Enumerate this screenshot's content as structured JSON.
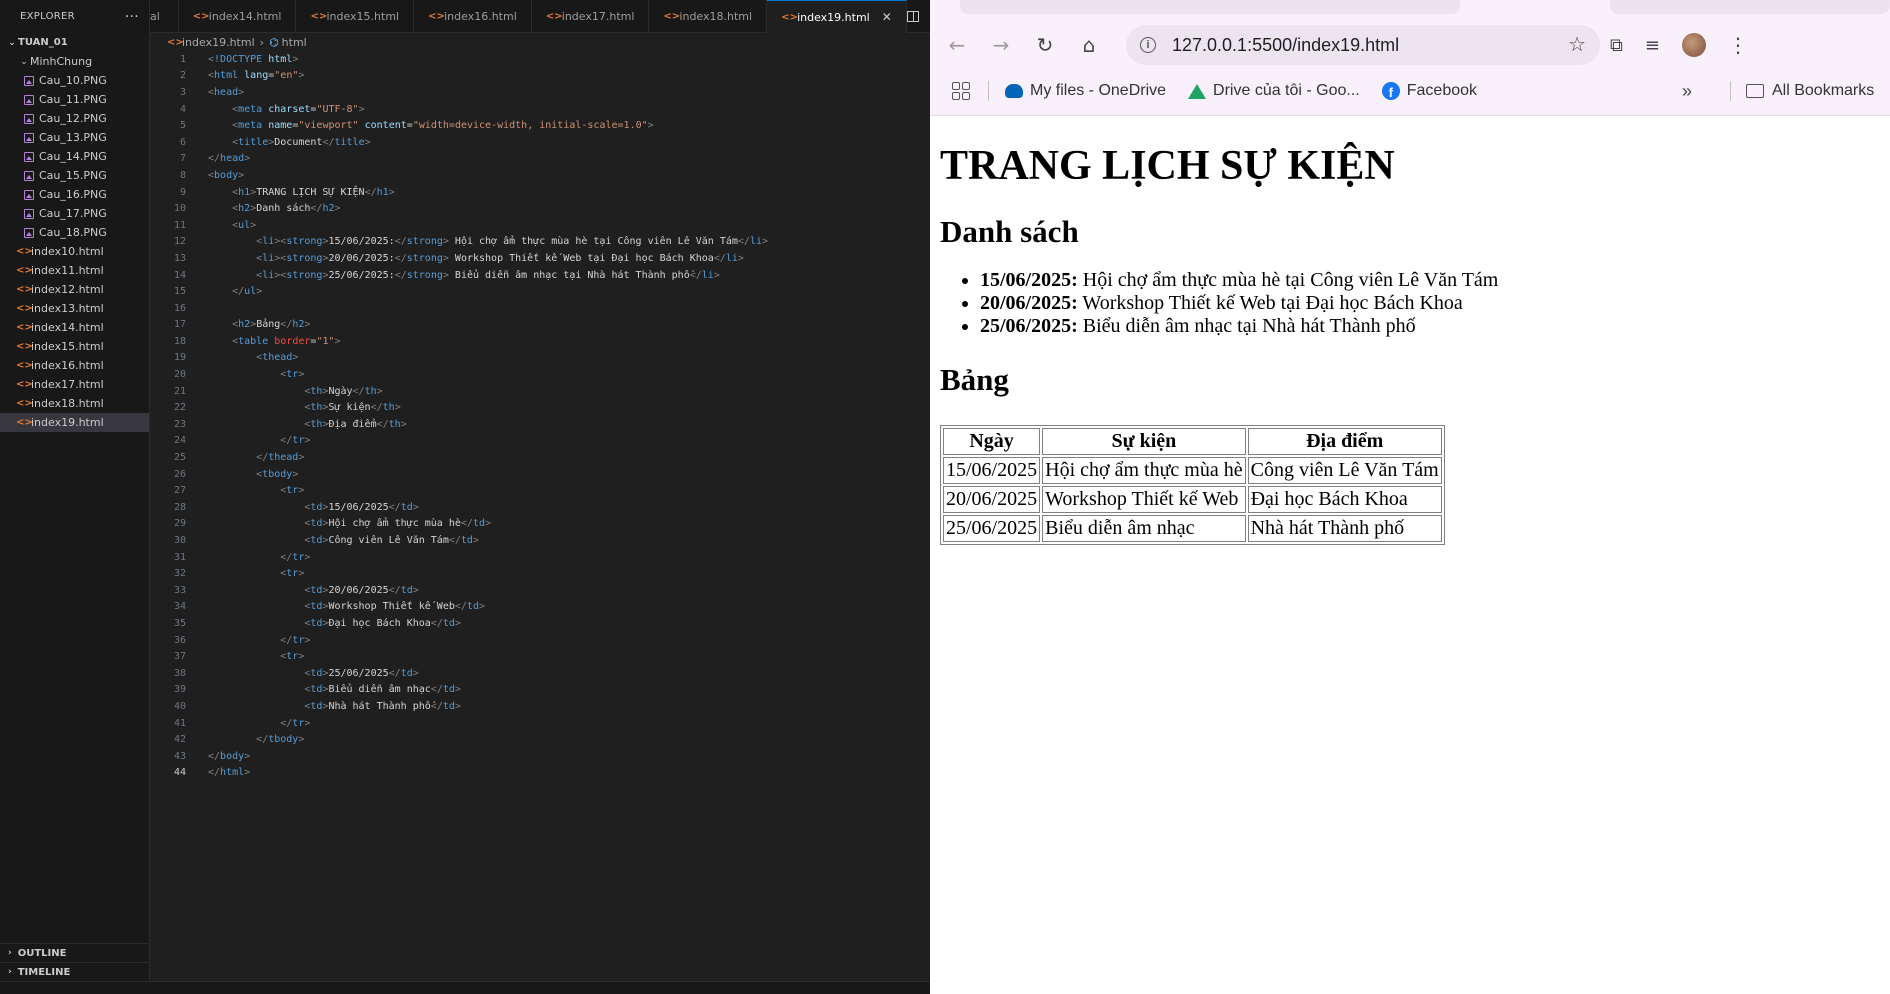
{
  "explorer": {
    "title": "EXPLORER",
    "root": "TUAN_01",
    "folder": "MinhChung",
    "images": [
      "Cau_10.PNG",
      "Cau_11.PNG",
      "Cau_12.PNG",
      "Cau_13.PNG",
      "Cau_14.PNG",
      "Cau_15.PNG",
      "Cau_16.PNG",
      "Cau_17.PNG",
      "Cau_18.PNG"
    ],
    "files": [
      "index10.html",
      "index11.html",
      "index12.html",
      "index13.html",
      "index14.html",
      "index15.html",
      "index16.html",
      "index17.html",
      "index18.html",
      "index19.html"
    ],
    "outline": "OUTLINE",
    "timeline": "TIMELINE"
  },
  "tabs": [
    {
      "label": "al"
    },
    {
      "label": "index14.html"
    },
    {
      "label": "index15.html"
    },
    {
      "label": "index16.html"
    },
    {
      "label": "index17.html"
    },
    {
      "label": "index18.html"
    },
    {
      "label": "index19.html"
    }
  ],
  "breadcrumb": {
    "file": "index19.html",
    "node": "html"
  },
  "browser": {
    "url": "127.0.0.1:5500/index19.html",
    "bookmarks": [
      "My files - OneDrive",
      "Drive của tôi - Goo...",
      "Facebook"
    ],
    "all_bookmarks": "All Bookmarks"
  },
  "page": {
    "h1": "TRANG LỊCH SỰ KIỆN",
    "h2_list": "Danh sách",
    "items": [
      {
        "date": "15/06/2025:",
        "text": " Hội chợ ẩm thực mùa hè tại Công viên Lê Văn Tám"
      },
      {
        "date": "20/06/2025:",
        "text": " Workshop Thiết kế Web tại Đại học Bách Khoa"
      },
      {
        "date": "25/06/2025:",
        "text": " Biểu diễn âm nhạc tại Nhà hát Thành phố"
      }
    ],
    "h2_table": "Bảng",
    "headers": [
      "Ngày",
      "Sự kiện",
      "Địa điểm"
    ],
    "rows": [
      [
        "15/06/2025",
        "Hội chợ ẩm thực mùa hè",
        "Công viên Lê Văn Tám"
      ],
      [
        "20/06/2025",
        "Workshop Thiết kế Web",
        "Đại học Bách Khoa"
      ],
      [
        "25/06/2025",
        "Biểu diễn âm nhạc",
        "Nhà hát Thành phố"
      ]
    ]
  },
  "code_lines": [
    "<!DOCTYPE html>",
    "<html lang=\"en\">",
    "<head>",
    "    <meta charset=\"UTF-8\">",
    "    <meta name=\"viewport\" content=\"width=device-width, initial-scale=1.0\">",
    "    <title>Document</title>",
    "</head>",
    "<body>",
    "    <h1>TRANG LỊCH SỰ KIỆN</h1>",
    "    <h2>Danh sách</h2>",
    "    <ul>",
    "        <li><strong>15/06/2025:</strong> Hội chợ ẩm thực mùa hè tại Công viên Lê Văn Tám</li>",
    "        <li><strong>20/06/2025:</strong> Workshop Thiết kế Web tại Đại học Bách Khoa</li>",
    "        <li><strong>25/06/2025:</strong> Biểu diễn âm nhạc tại Nhà hát Thành phố</li>",
    "    </ul>",
    "",
    "    <h2>Bảng</h2>",
    "    <table border=\"1\">",
    "        <thead>",
    "            <tr>",
    "                <th>Ngày</th>",
    "                <th>Sự kiện</th>",
    "                <th>Địa điểm</th>",
    "            </tr>",
    "        </thead>",
    "        <tbody>",
    "            <tr>",
    "                <td>15/06/2025</td>",
    "                <td>Hội chợ ẩm thực mùa hè</td>",
    "                <td>Công viên Lê Văn Tám</td>",
    "            </tr>",
    "            <tr>",
    "                <td>20/06/2025</td>",
    "                <td>Workshop Thiết kế Web</td>",
    "                <td>Đại học Bách Khoa</td>",
    "            </tr>",
    "            <tr>",
    "                <td>25/06/2025</td>",
    "                <td>Biểu diễn âm nhạc</td>",
    "                <td>Nhà hát Thành phố</td>",
    "            </tr>",
    "        </tbody>",
    "</body>",
    "</html>"
  ]
}
